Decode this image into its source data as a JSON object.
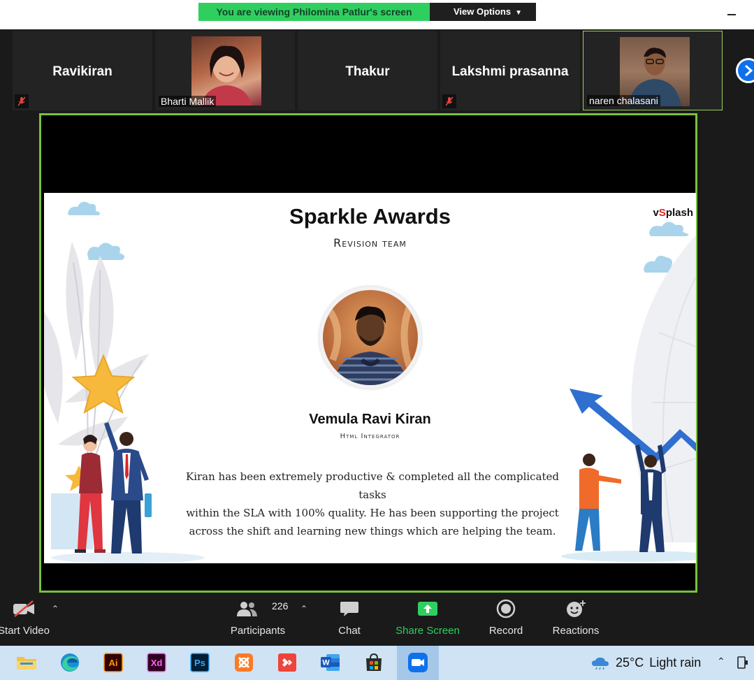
{
  "banner": {
    "viewing_text": "You are viewing Philomina Patlur's screen",
    "view_options_label": "View Options"
  },
  "participants_strip": [
    {
      "name": "Ravikiran",
      "muted": true
    },
    {
      "name": "Bharti Mallik",
      "muted": false
    },
    {
      "name": "Thakur",
      "muted": false
    },
    {
      "name": "Lakshmi prasanna",
      "muted": true
    },
    {
      "name": "naren chalasani",
      "muted": false
    }
  ],
  "slide": {
    "title": "Sparkle Awards",
    "subtitle": "Revision team",
    "brand_prefix": "v",
    "brand_s": "S",
    "brand_suffix": "plash",
    "person_name": "Vemula Ravi Kiran",
    "person_role": "Html Integrator",
    "description_lines": [
      "Kiran has been extremely productive & completed all the complicated tasks",
      "within the SLA with 100% quality.  He has been supporting the project",
      "across the shift and learning new things which are helping the team."
    ]
  },
  "toolbar": {
    "start_video": "Start Video",
    "participants": "Participants",
    "participants_count": "226",
    "chat": "Chat",
    "share_screen": "Share Screen",
    "record": "Record",
    "reactions": "Reactions"
  },
  "taskbar": {
    "apps": [
      "file-explorer",
      "edge",
      "illustrator",
      "xd",
      "photoshop",
      "xampp",
      "anydesk",
      "word",
      "store",
      "zoom"
    ],
    "illustrator_label": "Ai",
    "xd_label": "Xd",
    "photoshop_label": "Ps",
    "word_label": "W",
    "weather_temp": "25°C",
    "weather_desc": "Light rain"
  },
  "colors": {
    "banner_green": "#2fcf5f",
    "active_border": "#7cbf3f",
    "share_green": "#2fcf5f",
    "zoom_blue": "#0e71eb"
  }
}
